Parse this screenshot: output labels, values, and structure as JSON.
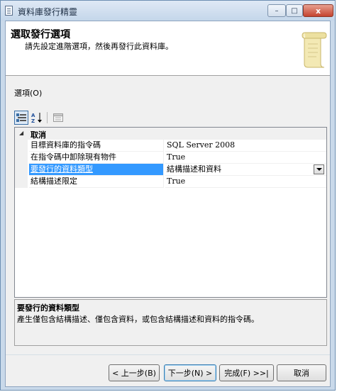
{
  "window": {
    "title": "資料庫發行精靈"
  },
  "titlebar_buttons": {
    "minimize": "–",
    "maximize": "□",
    "close": "x"
  },
  "header": {
    "title": "選取發行選項",
    "subtitle": "請先設定進階選項，然後再發行此資料庫。"
  },
  "options_label": "選項(O)",
  "grid": {
    "category": "取消",
    "rows": [
      {
        "name": "目標資料庫的指令碼",
        "value": "SQL Server 2008"
      },
      {
        "name": "在指令碼中卸除現有物件",
        "value": "True"
      },
      {
        "name": "要發行的資料類型",
        "value": "結構描述和資料"
      },
      {
        "name": "結構描述限定",
        "value": "True"
      }
    ]
  },
  "description": {
    "title": "要發行的資料類型",
    "text": "產生僅包含結構描述、僅包含資料，或包含結構描述和資料的指令碼。"
  },
  "buttons": {
    "back": "< 上一步(B)",
    "next": "下一步(N) >",
    "finish": "完成(F) >>|",
    "cancel": "取消"
  },
  "colors": {
    "selection": "#3399ff",
    "window_frame": "#c9d9ea"
  },
  "icons": [
    "document-icon",
    "categorized-icon",
    "alphabetical-sort-icon",
    "property-pages-icon",
    "scroll-icon"
  ]
}
